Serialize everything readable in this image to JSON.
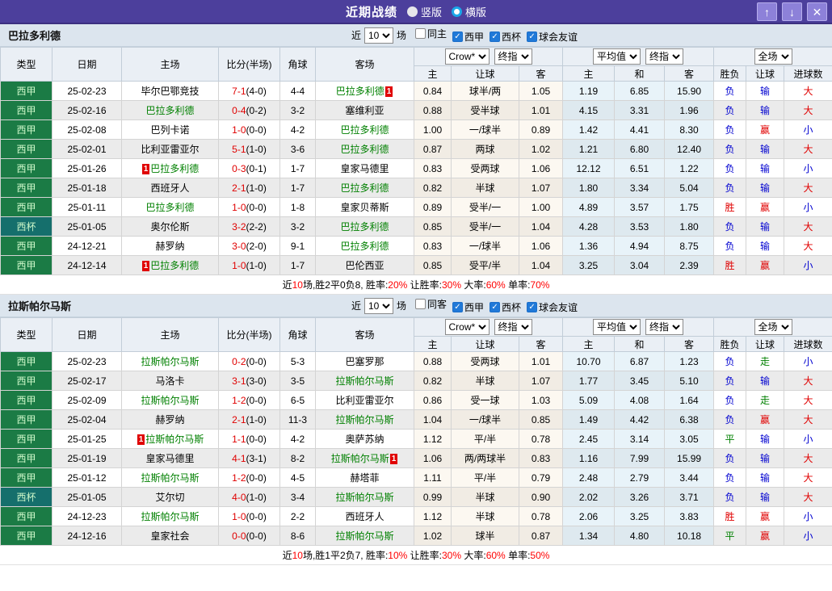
{
  "header": {
    "title": "近期战绩",
    "radio_vertical": "竖版",
    "radio_horizontal": "横版",
    "up_icon": "↑",
    "down_icon": "↓",
    "close_icon": "✕"
  },
  "filter_labels": {
    "near": "近",
    "count": "10",
    "games": "场"
  },
  "selects": {
    "crow": "Crow*",
    "final": "终指",
    "avg": "平均值",
    "full": "全场"
  },
  "columns": {
    "main": [
      "类型",
      "日期",
      "主场",
      "比分(半场)",
      "角球",
      "客场"
    ],
    "sub": [
      "主",
      "让球",
      "客",
      "主",
      "和",
      "客",
      "胜负",
      "让球",
      "进球数"
    ]
  },
  "colors": {
    "accent_purple": "#4c3f9c",
    "league_green": "#1b7b45",
    "cup_teal": "#156f6c",
    "win_red": "#e00000",
    "lose_blue": "#0000d0",
    "draw_green": "#008000"
  },
  "sections": [
    {
      "team": "巴拉多利德",
      "filters": [
        {
          "label": "同主",
          "cbc": ""
        },
        {
          "label": "西甲",
          "cbc": "checked"
        },
        {
          "label": "西杯",
          "cbc": "checked"
        },
        {
          "label": "球会友谊",
          "cbc": "checked"
        }
      ],
      "rows": [
        {
          "tk": "t-league",
          "type": "西甲",
          "date": "25-02-23",
          "hb1": "",
          "home": "毕尔巴鄂竞技",
          "hc": "",
          "hb2": "",
          "score": "7-1",
          "half": "(4-0)",
          "corner": "4-4",
          "ab1": "",
          "away": "巴拉多利德",
          "ac": "green",
          "ab2": "1",
          "o1": "0.84",
          "o2": "球半/两",
          "o3": "1.05",
          "a1": "1.19",
          "a2": "6.85",
          "a3": "15.90",
          "r1": "负",
          "r1c": "blue",
          "r2": "输",
          "r2c": "blue",
          "r3": "大",
          "r3c": "red"
        },
        {
          "tk": "t-league",
          "type": "西甲",
          "date": "25-02-16",
          "hb1": "",
          "home": "巴拉多利德",
          "hc": "green",
          "hb2": "",
          "score": "0-4",
          "half": "(0-2)",
          "corner": "3-2",
          "ab1": "",
          "away": "塞维利亚",
          "ac": "",
          "ab2": "",
          "o1": "0.88",
          "o2": "受半球",
          "o3": "1.01",
          "a1": "4.15",
          "a2": "3.31",
          "a3": "1.96",
          "r1": "负",
          "r1c": "blue",
          "r2": "输",
          "r2c": "blue",
          "r3": "大",
          "r3c": "red"
        },
        {
          "tk": "t-league",
          "type": "西甲",
          "date": "25-02-08",
          "hb1": "",
          "home": "巴列卡诺",
          "hc": "",
          "hb2": "",
          "score": "1-0",
          "half": "(0-0)",
          "corner": "4-2",
          "ab1": "",
          "away": "巴拉多利德",
          "ac": "green",
          "ab2": "",
          "o1": "1.00",
          "o2": "一/球半",
          "o3": "0.89",
          "a1": "1.42",
          "a2": "4.41",
          "a3": "8.30",
          "r1": "负",
          "r1c": "blue",
          "r2": "赢",
          "r2c": "red",
          "r3": "小",
          "r3c": "blue"
        },
        {
          "tk": "t-league",
          "type": "西甲",
          "date": "25-02-01",
          "hb1": "",
          "home": "比利亚雷亚尔",
          "hc": "",
          "hb2": "",
          "score": "5-1",
          "half": "(1-0)",
          "corner": "3-6",
          "ab1": "",
          "away": "巴拉多利德",
          "ac": "green",
          "ab2": "",
          "o1": "0.87",
          "o2": "两球",
          "o3": "1.02",
          "a1": "1.21",
          "a2": "6.80",
          "a3": "12.40",
          "r1": "负",
          "r1c": "blue",
          "r2": "输",
          "r2c": "blue",
          "r3": "大",
          "r3c": "red"
        },
        {
          "tk": "t-league",
          "type": "西甲",
          "date": "25-01-26",
          "hb1": "1",
          "home": "巴拉多利德",
          "hc": "green",
          "hb2": "",
          "score": "0-3",
          "half": "(0-1)",
          "corner": "1-7",
          "ab1": "",
          "away": "皇家马德里",
          "ac": "",
          "ab2": "",
          "o1": "0.83",
          "o2": "受两球",
          "o3": "1.06",
          "a1": "12.12",
          "a2": "6.51",
          "a3": "1.22",
          "r1": "负",
          "r1c": "blue",
          "r2": "输",
          "r2c": "blue",
          "r3": "小",
          "r3c": "blue"
        },
        {
          "tk": "t-league",
          "type": "西甲",
          "date": "25-01-18",
          "hb1": "",
          "home": "西班牙人",
          "hc": "",
          "hb2": "",
          "score": "2-1",
          "half": "(1-0)",
          "corner": "1-7",
          "ab1": "",
          "away": "巴拉多利德",
          "ac": "green",
          "ab2": "",
          "o1": "0.82",
          "o2": "半球",
          "o3": "1.07",
          "a1": "1.80",
          "a2": "3.34",
          "a3": "5.04",
          "r1": "负",
          "r1c": "blue",
          "r2": "输",
          "r2c": "blue",
          "r3": "大",
          "r3c": "red"
        },
        {
          "tk": "t-league",
          "type": "西甲",
          "date": "25-01-11",
          "hb1": "",
          "home": "巴拉多利德",
          "hc": "green",
          "hb2": "",
          "score": "1-0",
          "half": "(0-0)",
          "corner": "1-8",
          "ab1": "",
          "away": "皇家贝蒂斯",
          "ac": "",
          "ab2": "",
          "o1": "0.89",
          "o2": "受半/一",
          "o3": "1.00",
          "a1": "4.89",
          "a2": "3.57",
          "a3": "1.75",
          "r1": "胜",
          "r1c": "red",
          "r2": "赢",
          "r2c": "red",
          "r3": "小",
          "r3c": "blue"
        },
        {
          "tk": "t-cup",
          "type": "西杯",
          "date": "25-01-05",
          "hb1": "",
          "home": "奥尔伦斯",
          "hc": "",
          "hb2": "",
          "score": "3-2",
          "half": "(2-2)",
          "corner": "3-2",
          "ab1": "",
          "away": "巴拉多利德",
          "ac": "green",
          "ab2": "",
          "o1": "0.85",
          "o2": "受半/一",
          "o3": "1.04",
          "a1": "4.28",
          "a2": "3.53",
          "a3": "1.80",
          "r1": "负",
          "r1c": "blue",
          "r2": "输",
          "r2c": "blue",
          "r3": "大",
          "r3c": "red"
        },
        {
          "tk": "t-league",
          "type": "西甲",
          "date": "24-12-21",
          "hb1": "",
          "home": "赫罗纳",
          "hc": "",
          "hb2": "",
          "score": "3-0",
          "half": "(2-0)",
          "corner": "9-1",
          "ab1": "",
          "away": "巴拉多利德",
          "ac": "green",
          "ab2": "",
          "o1": "0.83",
          "o2": "一/球半",
          "o3": "1.06",
          "a1": "1.36",
          "a2": "4.94",
          "a3": "8.75",
          "r1": "负",
          "r1c": "blue",
          "r2": "输",
          "r2c": "blue",
          "r3": "大",
          "r3c": "red"
        },
        {
          "tk": "t-league",
          "type": "西甲",
          "date": "24-12-14",
          "hb1": "1",
          "home": "巴拉多利德",
          "hc": "green",
          "hb2": "",
          "score": "1-0",
          "half": "(1-0)",
          "corner": "1-7",
          "ab1": "",
          "away": "巴伦西亚",
          "ac": "",
          "ab2": "",
          "o1": "0.85",
          "o2": "受平/半",
          "o3": "1.04",
          "a1": "3.25",
          "a2": "3.04",
          "a3": "2.39",
          "r1": "胜",
          "r1c": "red",
          "r2": "赢",
          "r2c": "red",
          "r3": "小",
          "r3c": "blue"
        }
      ],
      "summary": [
        {
          "t": "近",
          "c": ""
        },
        {
          "t": "10",
          "c": "red"
        },
        {
          "t": "场,胜2平0负8, 胜率:",
          "c": ""
        },
        {
          "t": "20%",
          "c": "red"
        },
        {
          "t": " 让胜率:",
          "c": ""
        },
        {
          "t": "30%",
          "c": "red"
        },
        {
          "t": " 大率:",
          "c": ""
        },
        {
          "t": "60%",
          "c": "red"
        },
        {
          "t": " 单率:",
          "c": ""
        },
        {
          "t": "70%",
          "c": "red"
        }
      ]
    },
    {
      "team": "拉斯帕尔马斯",
      "filters": [
        {
          "label": "同客",
          "cbc": ""
        },
        {
          "label": "西甲",
          "cbc": "checked"
        },
        {
          "label": "西杯",
          "cbc": "checked"
        },
        {
          "label": "球会友谊",
          "cbc": "checked"
        }
      ],
      "rows": [
        {
          "tk": "t-league",
          "type": "西甲",
          "date": "25-02-23",
          "hb1": "",
          "home": "拉斯帕尔马斯",
          "hc": "green",
          "hb2": "",
          "score": "0-2",
          "half": "(0-0)",
          "corner": "5-3",
          "ab1": "",
          "away": "巴塞罗那",
          "ac": "",
          "ab2": "",
          "o1": "0.88",
          "o2": "受两球",
          "o3": "1.01",
          "a1": "10.70",
          "a2": "6.87",
          "a3": "1.23",
          "r1": "负",
          "r1c": "blue",
          "r2": "走",
          "r2c": "green",
          "r3": "小",
          "r3c": "blue"
        },
        {
          "tk": "t-league",
          "type": "西甲",
          "date": "25-02-17",
          "hb1": "",
          "home": "马洛卡",
          "hc": "",
          "hb2": "",
          "score": "3-1",
          "half": "(3-0)",
          "corner": "3-5",
          "ab1": "",
          "away": "拉斯帕尔马斯",
          "ac": "green",
          "ab2": "",
          "o1": "0.82",
          "o2": "半球",
          "o3": "1.07",
          "a1": "1.77",
          "a2": "3.45",
          "a3": "5.10",
          "r1": "负",
          "r1c": "blue",
          "r2": "输",
          "r2c": "blue",
          "r3": "大",
          "r3c": "red"
        },
        {
          "tk": "t-league",
          "type": "西甲",
          "date": "25-02-09",
          "hb1": "",
          "home": "拉斯帕尔马斯",
          "hc": "green",
          "hb2": "",
          "score": "1-2",
          "half": "(0-0)",
          "corner": "6-5",
          "ab1": "",
          "away": "比利亚雷亚尔",
          "ac": "",
          "ab2": "",
          "o1": "0.86",
          "o2": "受一球",
          "o3": "1.03",
          "a1": "5.09",
          "a2": "4.08",
          "a3": "1.64",
          "r1": "负",
          "r1c": "blue",
          "r2": "走",
          "r2c": "green",
          "r3": "大",
          "r3c": "red"
        },
        {
          "tk": "t-league",
          "type": "西甲",
          "date": "25-02-04",
          "hb1": "",
          "home": "赫罗纳",
          "hc": "",
          "hb2": "",
          "score": "2-1",
          "half": "(1-0)",
          "corner": "11-3",
          "ab1": "",
          "away": "拉斯帕尔马斯",
          "ac": "green",
          "ab2": "",
          "o1": "1.04",
          "o2": "一/球半",
          "o3": "0.85",
          "a1": "1.49",
          "a2": "4.42",
          "a3": "6.38",
          "r1": "负",
          "r1c": "blue",
          "r2": "赢",
          "r2c": "red",
          "r3": "大",
          "r3c": "red"
        },
        {
          "tk": "t-league",
          "type": "西甲",
          "date": "25-01-25",
          "hb1": "1",
          "home": "拉斯帕尔马斯",
          "hc": "green",
          "hb2": "",
          "score": "1-1",
          "half": "(0-0)",
          "corner": "4-2",
          "ab1": "",
          "away": "奥萨苏纳",
          "ac": "",
          "ab2": "",
          "o1": "1.12",
          "o2": "平/半",
          "o3": "0.78",
          "a1": "2.45",
          "a2": "3.14",
          "a3": "3.05",
          "r1": "平",
          "r1c": "green",
          "r2": "输",
          "r2c": "blue",
          "r3": "小",
          "r3c": "blue"
        },
        {
          "tk": "t-league",
          "type": "西甲",
          "date": "25-01-19",
          "hb1": "",
          "home": "皇家马德里",
          "hc": "",
          "hb2": "",
          "score": "4-1",
          "half": "(3-1)",
          "corner": "8-2",
          "ab1": "",
          "away": "拉斯帕尔马斯",
          "ac": "green",
          "ab2": "1",
          "o1": "1.06",
          "o2": "两/两球半",
          "o3": "0.83",
          "a1": "1.16",
          "a2": "7.99",
          "a3": "15.99",
          "r1": "负",
          "r1c": "blue",
          "r2": "输",
          "r2c": "blue",
          "r3": "大",
          "r3c": "red"
        },
        {
          "tk": "t-league",
          "type": "西甲",
          "date": "25-01-12",
          "hb1": "",
          "home": "拉斯帕尔马斯",
          "hc": "green",
          "hb2": "",
          "score": "1-2",
          "half": "(0-0)",
          "corner": "4-5",
          "ab1": "",
          "away": "赫塔菲",
          "ac": "",
          "ab2": "",
          "o1": "1.11",
          "o2": "平/半",
          "o3": "0.79",
          "a1": "2.48",
          "a2": "2.79",
          "a3": "3.44",
          "r1": "负",
          "r1c": "blue",
          "r2": "输",
          "r2c": "blue",
          "r3": "大",
          "r3c": "red"
        },
        {
          "tk": "t-cup",
          "type": "西杯",
          "date": "25-01-05",
          "hb1": "",
          "home": "艾尔切",
          "hc": "",
          "hb2": "",
          "score": "4-0",
          "half": "(1-0)",
          "corner": "3-4",
          "ab1": "",
          "away": "拉斯帕尔马斯",
          "ac": "green",
          "ab2": "",
          "o1": "0.99",
          "o2": "半球",
          "o3": "0.90",
          "a1": "2.02",
          "a2": "3.26",
          "a3": "3.71",
          "r1": "负",
          "r1c": "blue",
          "r2": "输",
          "r2c": "blue",
          "r3": "大",
          "r3c": "red"
        },
        {
          "tk": "t-league",
          "type": "西甲",
          "date": "24-12-23",
          "hb1": "",
          "home": "拉斯帕尔马斯",
          "hc": "green",
          "hb2": "",
          "score": "1-0",
          "half": "(0-0)",
          "corner": "2-2",
          "ab1": "",
          "away": "西班牙人",
          "ac": "",
          "ab2": "",
          "o1": "1.12",
          "o2": "半球",
          "o3": "0.78",
          "a1": "2.06",
          "a2": "3.25",
          "a3": "3.83",
          "r1": "胜",
          "r1c": "red",
          "r2": "赢",
          "r2c": "red",
          "r3": "小",
          "r3c": "blue"
        },
        {
          "tk": "t-league",
          "type": "西甲",
          "date": "24-12-16",
          "hb1": "",
          "home": "皇家社会",
          "hc": "",
          "hb2": "",
          "score": "0-0",
          "half": "(0-0)",
          "corner": "8-6",
          "ab1": "",
          "away": "拉斯帕尔马斯",
          "ac": "green",
          "ab2": "",
          "o1": "1.02",
          "o2": "球半",
          "o3": "0.87",
          "a1": "1.34",
          "a2": "4.80",
          "a3": "10.18",
          "r1": "平",
          "r1c": "green",
          "r2": "赢",
          "r2c": "red",
          "r3": "小",
          "r3c": "blue"
        }
      ],
      "summary": [
        {
          "t": "近",
          "c": ""
        },
        {
          "t": "10",
          "c": "red"
        },
        {
          "t": "场,胜1平2负7, 胜率:",
          "c": ""
        },
        {
          "t": "10%",
          "c": "red"
        },
        {
          "t": " 让胜率:",
          "c": ""
        },
        {
          "t": "30%",
          "c": "red"
        },
        {
          "t": " 大率:",
          "c": ""
        },
        {
          "t": "60%",
          "c": "red"
        },
        {
          "t": " 单率:",
          "c": ""
        },
        {
          "t": "50%",
          "c": "red"
        }
      ]
    }
  ]
}
